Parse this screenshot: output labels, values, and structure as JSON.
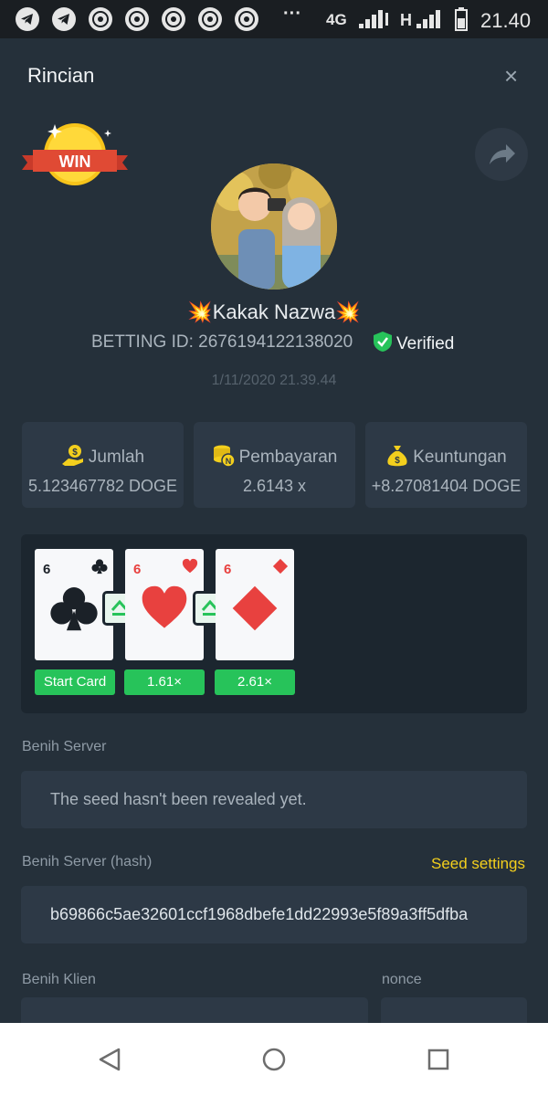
{
  "status_bar": {
    "dots": "···",
    "network": "4G",
    "network2": "H",
    "time": "21.40"
  },
  "header": {
    "title": "Rincian",
    "close": "×"
  },
  "badge": {
    "win": "WIN"
  },
  "profile": {
    "name": "💥Kakak Nazwa💥",
    "betting_id": "BETTING ID: 2676194122138020",
    "verified": "Verified",
    "timestamp": "1/11/2020 21.39.44"
  },
  "stats": [
    {
      "label": "Jumlah",
      "value": "5.123467782 DOGE",
      "icon": "hand-coin-icon"
    },
    {
      "label": "Pembayaran",
      "value": "2.6143 x",
      "icon": "coin-stack-icon"
    },
    {
      "label": "Keuntungan",
      "value": "+8.27081404 DOGE",
      "icon": "money-bag-icon"
    }
  ],
  "cards": [
    {
      "rank": "6",
      "suit": "clubs",
      "label": "Start Card"
    },
    {
      "rank": "6",
      "suit": "hearts",
      "label": "1.61×"
    },
    {
      "rank": "6",
      "suit": "diamonds",
      "label": "2.61×"
    }
  ],
  "colors": {
    "background": "#25303a",
    "panel": "#2d3946",
    "accent_green": "#27c35a",
    "accent_yellow": "#f3cf1d",
    "card_red": "#e8413f"
  },
  "fields": {
    "server_seed_label": "Benih Server",
    "server_seed_value": "The seed hasn't been revealed yet.",
    "server_hash_label": "Benih Server (hash)",
    "seed_settings": "Seed settings",
    "server_hash_value": "b69866c5ae32601ccf1968dbefe1dd22993e5f89a3ff5dfba",
    "client_seed_label": "Benih Klien",
    "nonce_label": "nonce"
  }
}
